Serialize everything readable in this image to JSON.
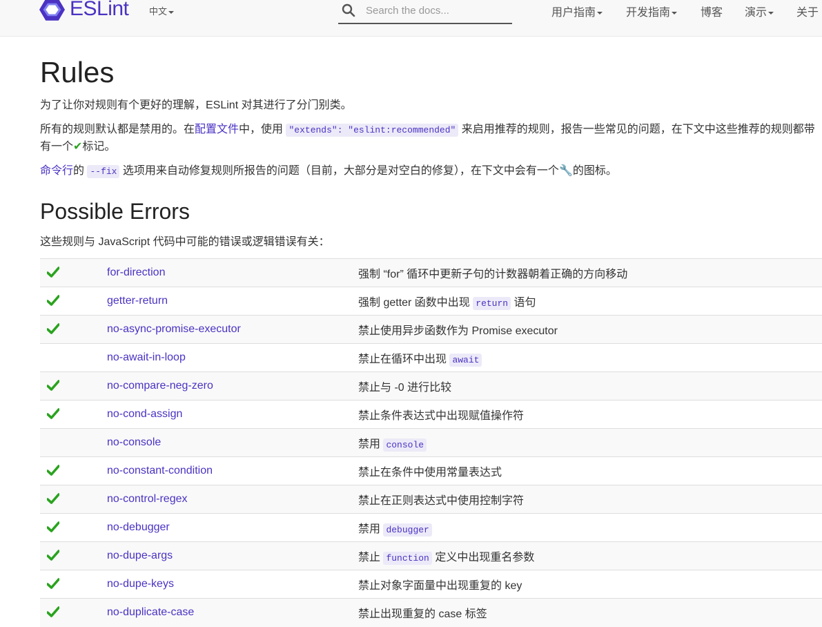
{
  "header": {
    "logo_text": "ESLint",
    "lang_label": "中文",
    "search": {
      "placeholder": "Search the docs..."
    },
    "nav": [
      {
        "label": "用户指南",
        "dropdown": true
      },
      {
        "label": "开发指南",
        "dropdown": true
      },
      {
        "label": "博客",
        "dropdown": false
      },
      {
        "label": "演示",
        "dropdown": true
      },
      {
        "label": "关于",
        "dropdown": true
      }
    ]
  },
  "page": {
    "title": "Rules",
    "intro": "为了让你对规则有个更好的理解，ESLint 对其进行了分门别类。",
    "p2": {
      "before": "所有的规则默认都是禁用的。在",
      "link": "配置文件",
      "middle": "中，使用 ",
      "code": "\"extends\": \"eslint:recommended\"",
      "after": " 来启用推荐的规则，报告一些常见的问题，在下文中这些推荐的规则都带有一个",
      "after2": "标记。"
    },
    "p3": {
      "link": "命令行",
      "before": "的 ",
      "code": "--fix",
      "after": " 选项用来自动修复规则所报告的问题（目前，大部分是对空白的修复），在下文中会有一个",
      "after2": "的图标。"
    }
  },
  "section": {
    "title": "Possible Errors",
    "description": "这些规则与 JavaScript 代码中可能的错误或逻辑错误有关：",
    "rules": [
      {
        "recommended": true,
        "name": "for-direction",
        "desc": "强制 “for” 循环中更新子句的计数器朝着正确的方向移动",
        "code": "",
        "desc_after": ""
      },
      {
        "recommended": true,
        "name": "getter-return",
        "desc": "强制 getter 函数中出现 ",
        "code": "return",
        "desc_after": " 语句"
      },
      {
        "recommended": true,
        "name": "no-async-promise-executor",
        "desc": "禁止使用异步函数作为 Promise executor",
        "code": "",
        "desc_after": ""
      },
      {
        "recommended": false,
        "name": "no-await-in-loop",
        "desc": "禁止在循环中出现 ",
        "code": "await",
        "desc_after": ""
      },
      {
        "recommended": true,
        "name": "no-compare-neg-zero",
        "desc": "禁止与 -0 进行比较",
        "code": "",
        "desc_after": ""
      },
      {
        "recommended": true,
        "name": "no-cond-assign",
        "desc": "禁止条件表达式中出现赋值操作符",
        "code": "",
        "desc_after": ""
      },
      {
        "recommended": false,
        "name": "no-console",
        "desc": "禁用 ",
        "code": "console",
        "desc_after": ""
      },
      {
        "recommended": true,
        "name": "no-constant-condition",
        "desc": "禁止在条件中使用常量表达式",
        "code": "",
        "desc_after": ""
      },
      {
        "recommended": true,
        "name": "no-control-regex",
        "desc": "禁止在正则表达式中使用控制字符",
        "code": "",
        "desc_after": ""
      },
      {
        "recommended": true,
        "name": "no-debugger",
        "desc": "禁用 ",
        "code": "debugger",
        "desc_after": ""
      },
      {
        "recommended": true,
        "name": "no-dupe-args",
        "desc": "禁止 ",
        "code": "function",
        "desc_after": " 定义中出现重名参数"
      },
      {
        "recommended": true,
        "name": "no-dupe-keys",
        "desc": "禁止对象字面量中出现重复的 key",
        "code": "",
        "desc_after": ""
      },
      {
        "recommended": true,
        "name": "no-duplicate-case",
        "desc": "禁止出现重复的 case 标签",
        "code": "",
        "desc_after": ""
      }
    ]
  },
  "colors": {
    "brand": "#4b32c3",
    "check": "#2aa31e",
    "wrench": "#f0a030"
  },
  "icons": {
    "check": "check-icon",
    "wrench": "wrench-icon",
    "search": "search-icon",
    "logo": "eslint-logo-icon"
  }
}
